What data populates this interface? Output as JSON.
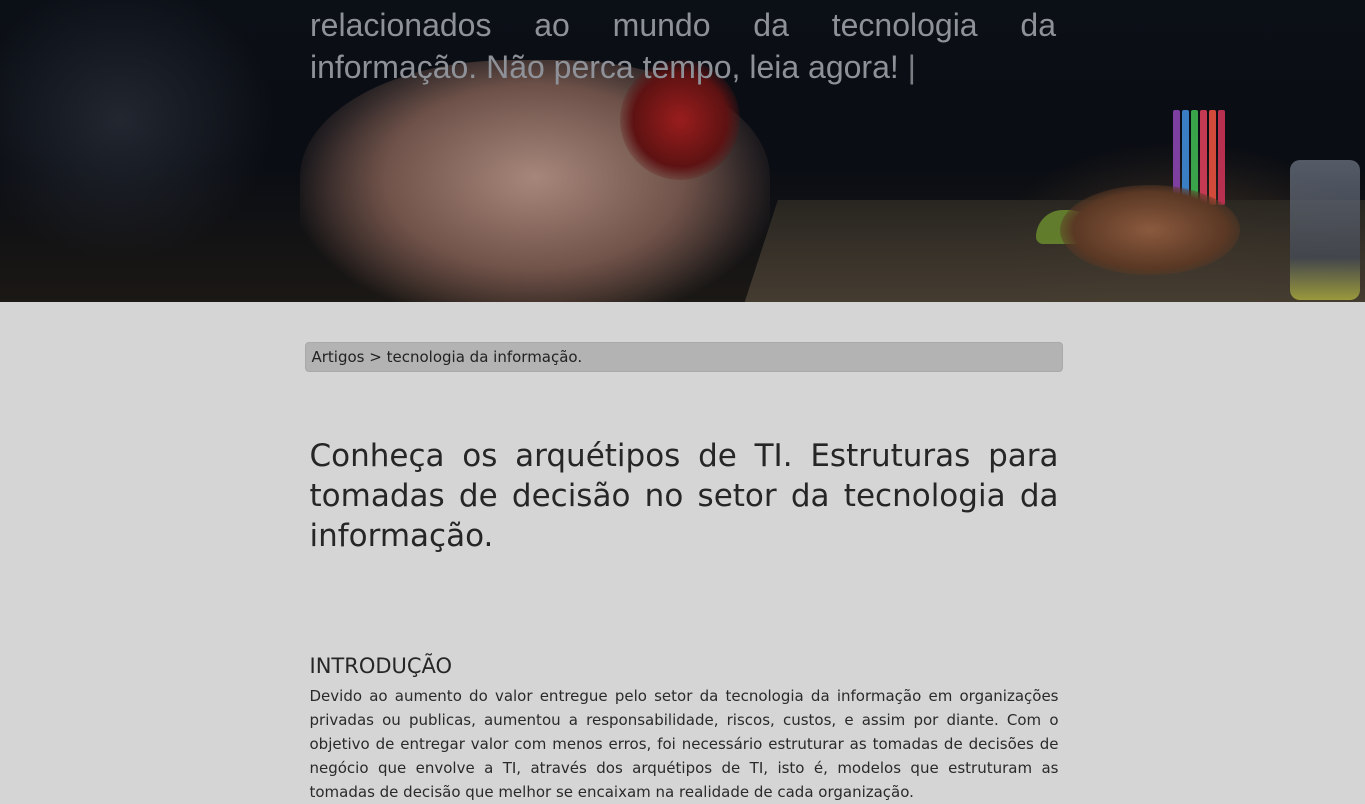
{
  "hero": {
    "text": "relacionados ao mundo da tecnologia da informação. Não perca tempo, leia agora!",
    "cursor": "|"
  },
  "breadcrumb": {
    "items": [
      "Artigos",
      "tecnologia da informação."
    ],
    "separator": ">"
  },
  "article": {
    "title": "Conheça os arquétipos de TI. Estruturas para tomadas de decisão no setor da tecnologia da informação.",
    "section_heading": "INTRODUÇÃO",
    "intro_paragraph": "Devido ao aumento do valor entregue pelo setor da tecnologia da informação em organizações privadas ou publicas, aumentou a responsabilidade, riscos, custos, e assim por diante. Com o objetivo de entregar valor com menos erros, foi necessário estruturar as tomadas de decisões de negócio que envolve a TI, através dos arquétipos de TI, isto é, modelos que estruturam as tomadas de decisão que melhor se encaixam na realidade de cada organização."
  },
  "colors": {
    "page_background": "#d5d5d5",
    "breadcrumb_background": "#b3b3b3",
    "hero_text": "#8e9298"
  }
}
